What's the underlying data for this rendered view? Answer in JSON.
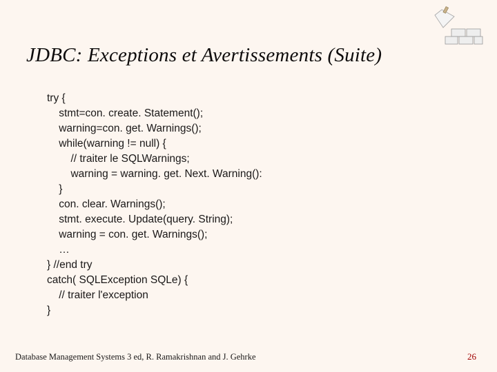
{
  "title": "JDBC: Exceptions et Avertissements (Suite)",
  "code": "try {\n    stmt=con. create. Statement();\n    warning=con. get. Warnings();\n    while(warning != null) {\n        // traiter le SQLWarnings;\n        warning = warning. get. Next. Warning():\n    }\n    con. clear. Warnings();\n    stmt. execute. Update(query. String);\n    warning = con. get. Warnings();\n    …\n} //end try\ncatch( SQLException SQLe) {\n    // traiter l'exception\n}",
  "footer_left": "Database Management Systems 3 ed,  R. Ramakrishnan and J. Gehrke",
  "page_number": "26"
}
